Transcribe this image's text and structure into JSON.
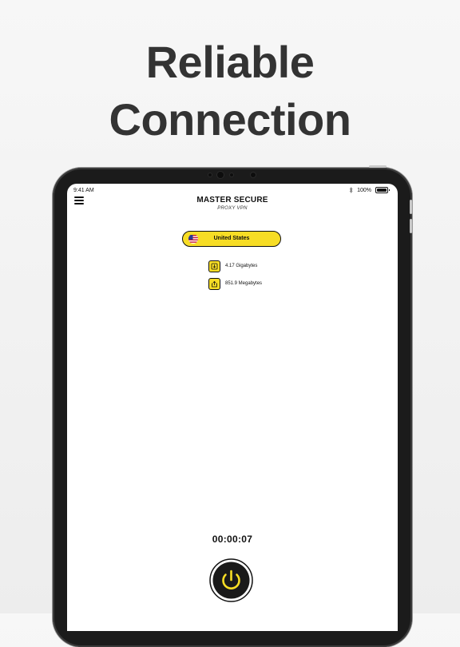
{
  "headline": {
    "line1": "Reliable",
    "line2": "Connection"
  },
  "status_bar": {
    "time": "9:41 AM",
    "battery": "100%"
  },
  "app": {
    "title": "MASTER SECURE",
    "subtitle": "PROXY VPN"
  },
  "location": {
    "country": "United States"
  },
  "stats": {
    "download": "4.17 Gigabytes",
    "upload": "851.9 Megabytes"
  },
  "session": {
    "timer": "00:00:07"
  },
  "colors": {
    "accent": "#f7dd25",
    "ink": "#111111",
    "background": "#f4f4f4"
  }
}
